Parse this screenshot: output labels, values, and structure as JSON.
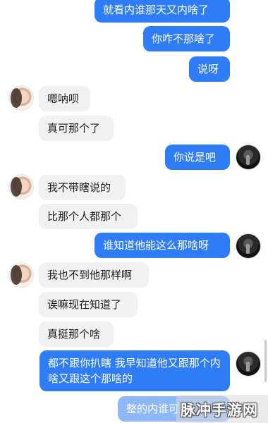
{
  "messages": [
    {
      "side": "out",
      "text": "就看内谁那天又内啥了"
    },
    {
      "side": "out",
      "text": "你咋不那啥了"
    },
    {
      "side": "out",
      "text": "说呀"
    },
    {
      "side": "in",
      "text": "嗯呐呗"
    },
    {
      "side": "in",
      "text": "真可那个了"
    },
    {
      "side": "out",
      "text": "你说是吧"
    },
    {
      "side": "in",
      "text": "我不带瞎说的"
    },
    {
      "side": "in",
      "text": "比那个人都那个"
    },
    {
      "side": "out",
      "text": "谁知道他能这么那啥呀"
    },
    {
      "side": "in",
      "text": "我也不到他那样啊"
    },
    {
      "side": "in",
      "text": "诶嘛现在知道了"
    },
    {
      "side": "in",
      "text": "真挺那个啥"
    },
    {
      "side": "out",
      "text": "都不跟你扒瞎 我早知道他又跟那个内啥又跟这个那啥的"
    },
    {
      "side": "out",
      "text": "整的内谁可"
    }
  ],
  "avatars": {
    "contact": "girl-avatar",
    "self": "dark-avatar"
  },
  "watermark": "脉冲手游网",
  "colors": {
    "outgoing_bubble": "#2f7df6",
    "incoming_bubble": "#f1f1f1",
    "background": "#ffffff"
  }
}
